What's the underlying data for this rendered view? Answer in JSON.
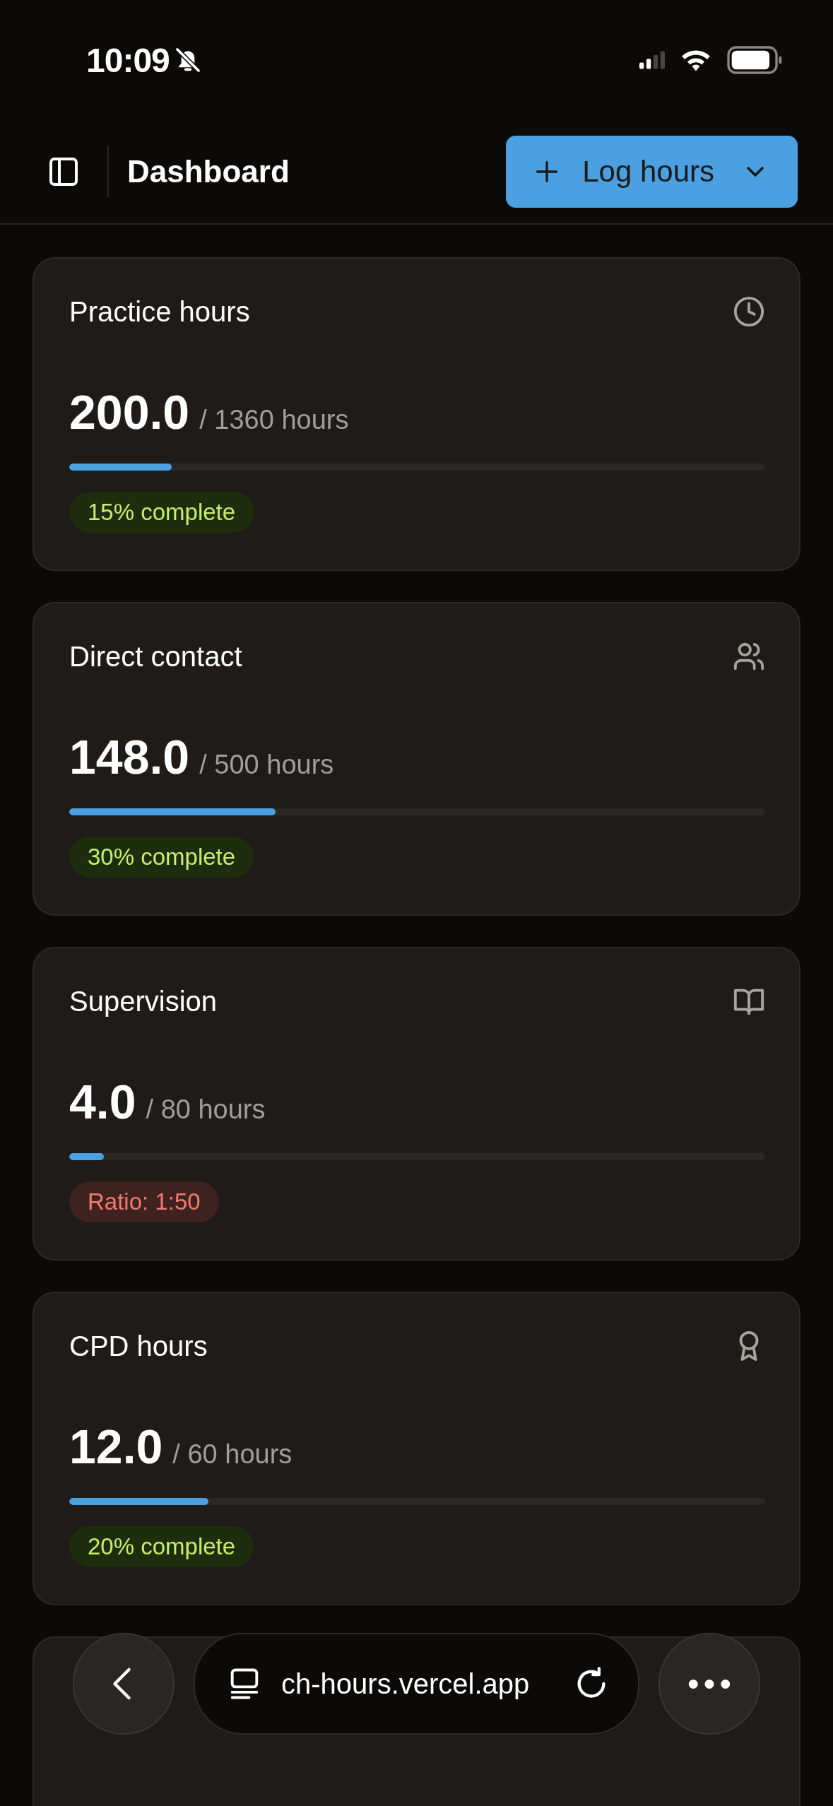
{
  "status_bar": {
    "time": "10:09",
    "silent": true
  },
  "header": {
    "title": "Dashboard",
    "action": {
      "label": "Log hours"
    }
  },
  "cards": [
    {
      "title": "Practice hours",
      "value": "200.0",
      "target": "/ 1360 hours",
      "level": 0.147,
      "badge": {
        "text": "15% complete",
        "kind": "good"
      }
    },
    {
      "title": "Direct contact",
      "value": "148.0",
      "target": "/ 500 hours",
      "level": 0.296,
      "badge": {
        "text": "30% complete",
        "kind": "good"
      }
    },
    {
      "title": "Supervision",
      "value": "4.0",
      "target": "/ 80 hours",
      "level": 0.05,
      "badge": {
        "text": "Ratio: 1:50",
        "kind": "bad"
      }
    },
    {
      "title": "CPD hours",
      "value": "12.0",
      "target": "/ 60 hours",
      "level": 0.2,
      "badge": {
        "text": "20% complete",
        "kind": "good"
      }
    }
  ],
  "browser_bar": {
    "url": "ch-hours.vercel.app"
  }
}
